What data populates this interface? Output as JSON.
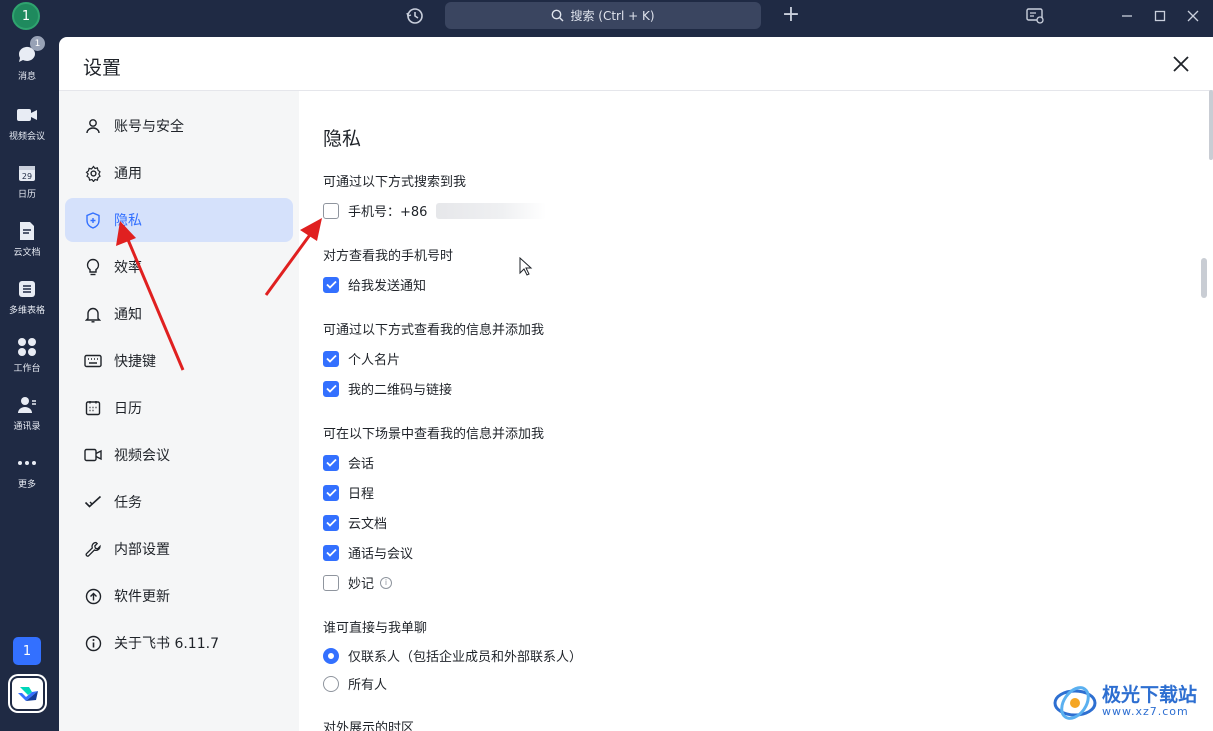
{
  "titlebar": {
    "avatar_initial": "1",
    "search_placeholder": "搜索 (Ctrl + K)",
    "plus": "+"
  },
  "rail": {
    "items": [
      {
        "label": "消息",
        "icon": "message-icon",
        "badge": "1"
      },
      {
        "label": "视频会议",
        "icon": "video-icon"
      },
      {
        "label": "日历",
        "icon": "calendar-icon",
        "day": "29"
      },
      {
        "label": "云文档",
        "icon": "cloud-doc-icon"
      },
      {
        "label": "多维表格",
        "icon": "table-icon"
      },
      {
        "label": "工作台",
        "icon": "workbench-icon"
      },
      {
        "label": "通讯录",
        "icon": "contacts-icon"
      },
      {
        "label": "更多",
        "icon": "more-icon"
      }
    ],
    "user_initial": "1"
  },
  "settings": {
    "title": "设置",
    "nav": [
      {
        "label": "账号与安全",
        "icon": "user-icon"
      },
      {
        "label": "通用",
        "icon": "gear-icon"
      },
      {
        "label": "隐私",
        "icon": "shield-icon",
        "active": true
      },
      {
        "label": "效率",
        "icon": "bulb-icon"
      },
      {
        "label": "通知",
        "icon": "bell-icon"
      },
      {
        "label": "快捷键",
        "icon": "keyboard-icon"
      },
      {
        "label": "日历",
        "icon": "calendar-icon"
      },
      {
        "label": "视频会议",
        "icon": "video-icon"
      },
      {
        "label": "任务",
        "icon": "task-icon"
      },
      {
        "label": "内部设置",
        "icon": "wrench-icon"
      },
      {
        "label": "软件更新",
        "icon": "upload-icon"
      },
      {
        "label": "关于飞书 6.11.7",
        "icon": "info-icon"
      }
    ]
  },
  "privacy": {
    "title": "隐私",
    "search_section": "可通过以下方式搜索到我",
    "phone_label": "手机号：+86",
    "phone_checked": false,
    "view_phone_section": "对方查看我的手机号时",
    "notify_label": "给我发送通知",
    "notify_checked": true,
    "add_section": "可通过以下方式查看我的信息并添加我",
    "add_options": [
      {
        "label": "个人名片",
        "checked": true
      },
      {
        "label": "我的二维码与链接",
        "checked": true
      }
    ],
    "scene_section": "可在以下场景中查看我的信息并添加我",
    "scene_options": [
      {
        "label": "会话",
        "checked": true
      },
      {
        "label": "日程",
        "checked": true
      },
      {
        "label": "云文档",
        "checked": true
      },
      {
        "label": "通话与会议",
        "checked": true
      },
      {
        "label": "妙记",
        "checked": false
      }
    ],
    "chat_section": "谁可直接与我单聊",
    "chat_options": [
      {
        "label": "仅联系人（包括企业成员和外部联系人）",
        "selected": true
      },
      {
        "label": "所有人",
        "selected": false
      }
    ],
    "timezone_section": "对外展示的时区"
  },
  "watermark": {
    "line1": "极光下载站",
    "line2": "www.xz7.com"
  },
  "colors": {
    "accent": "#3370ff",
    "rail_bg": "#1f2a44",
    "annotation_arrow": "#e02020"
  }
}
